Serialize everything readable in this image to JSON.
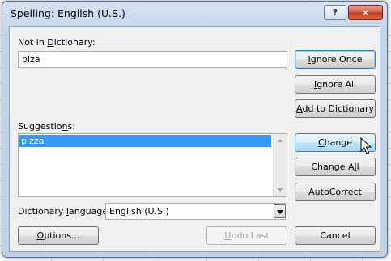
{
  "window": {
    "title": "Spelling: English (U.S.)",
    "help_label": "?",
    "close_label": "✕"
  },
  "not_in_dictionary": {
    "label_pre": "Not in ",
    "label_key": "D",
    "label_post": "ictionary:",
    "value": "piza"
  },
  "suggestions": {
    "label_pre": "Suggestio",
    "label_key": "n",
    "label_post": "s:",
    "items": [
      "pizza"
    ],
    "selected_index": 0
  },
  "dictionary_language": {
    "label_pre": "Dictionary ",
    "label_key": "l",
    "label_post": "anguage:",
    "value": "English (U.S.)"
  },
  "buttons": {
    "ignore_once": {
      "key": "I",
      "rest": "gnore Once"
    },
    "ignore_all": {
      "key": "I",
      "rest": "gnore All",
      "underline_char": "g"
    },
    "add_to_dictionary": {
      "key": "A",
      "rest": "dd to Dictionary"
    },
    "change": {
      "key": "C",
      "rest": "hange"
    },
    "change_all": {
      "pre": "Change A",
      "key": "l",
      "rest": "l"
    },
    "autocorrect": {
      "pre": "Aut",
      "key": "o",
      "rest": "Correct"
    },
    "options": {
      "key": "O",
      "rest": "ptions..."
    },
    "undo_last": {
      "key": "U",
      "rest": "ndo Last"
    },
    "cancel": {
      "label": "Cancel"
    }
  },
  "colors": {
    "selection": "#3399ff",
    "default_button_border": "#3c7fb1",
    "close_button": "#c43b22"
  }
}
